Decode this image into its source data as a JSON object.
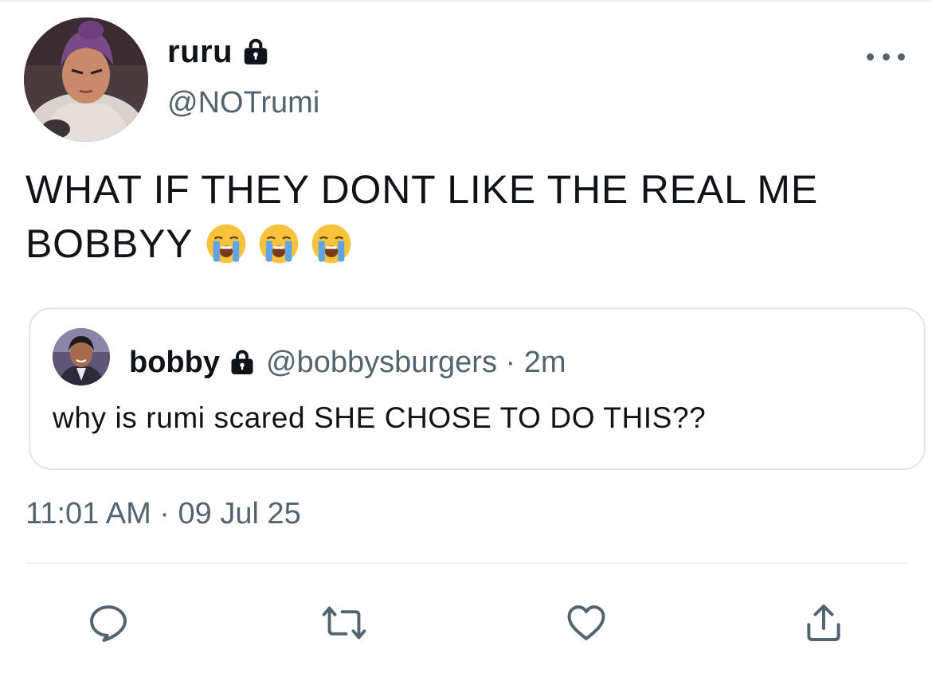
{
  "author": {
    "display_name": "ruru",
    "handle": "@NOTrumi",
    "protected_icon": "lock-icon"
  },
  "tweet": {
    "text": "WHAT IF THEY DONT LIKE THE REAL ME BOBBYY",
    "emojis": [
      "loudly-crying-face",
      "loudly-crying-face",
      "loudly-crying-face"
    ]
  },
  "quoted_tweet": {
    "display_name": "bobby",
    "handle_time": "@bobbysburgers · 2m",
    "text": "why is rumi scared SHE CHOSE TO DO THIS??",
    "protected_icon": "lock-icon"
  },
  "timestamp": "11:01 AM · 09 Jul 25",
  "actions": {
    "reply_icon": "reply-icon",
    "retweet_icon": "retweet-icon",
    "like_icon": "heart-icon",
    "share_icon": "share-icon"
  },
  "colors": {
    "text": "#0f1419",
    "secondary": "#536471",
    "border": "#dfe5e8",
    "emoji_face": "#f9c23c",
    "tears": "#5ea4e8"
  }
}
